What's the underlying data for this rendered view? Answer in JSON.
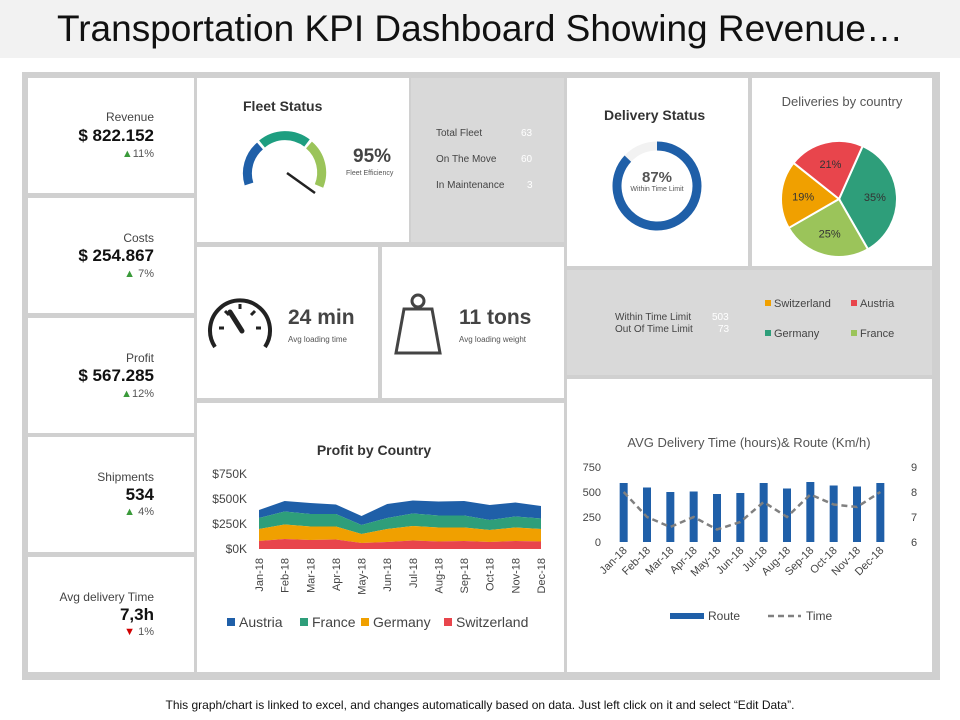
{
  "title": "Transportation KPI Dashboard Showing Revenue…",
  "footer": "This graph/chart is linked to excel, and changes automatically based on data. Just left click on it and select “Edit Data”.",
  "kpis": [
    {
      "label": "Revenue",
      "value": "$ 822.152",
      "change": "11%",
      "direction": "up"
    },
    {
      "label": "Costs",
      "value": "$ 254.867",
      "change": " 7%",
      "direction": "up"
    },
    {
      "label": "Profit",
      "value": "$ 567.285",
      "change": "12%",
      "direction": "up"
    },
    {
      "label": "Shipments",
      "value": "534",
      "change": " 4%",
      "direction": "up"
    },
    {
      "label": "Avg delivery Time",
      "value": "7,3h",
      "change": " 1%",
      "direction": "down"
    }
  ],
  "fleet": {
    "title": "Fleet Status",
    "pct": "95%",
    "pct_label": "Fleet Efficiency",
    "efficiency": 0.95,
    "stats": [
      {
        "label": "Total Fleet",
        "value": "63"
      },
      {
        "label": "On The Move",
        "value": "60"
      },
      {
        "label": "In Maintenance",
        "value": "3"
      }
    ]
  },
  "loading_time": {
    "value": "24 min",
    "label": "Avg loading time"
  },
  "loading_weight": {
    "value": "11 tons",
    "label": "Avg loading weight"
  },
  "delivery": {
    "title": "Delivery Status",
    "pct": "87%",
    "pct_label": "Within Time Limit",
    "fraction": 0.87,
    "stats": [
      {
        "label": "Within Time Limit",
        "value": "503"
      },
      {
        "label": "Out Of Time  Limit",
        "value": "73"
      }
    ]
  },
  "colors": {
    "blue": "#1f5fa8",
    "green": "#2e9e7a",
    "orange": "#f0a000",
    "red": "#e8454c",
    "lightgreen": "#9bc45a",
    "gauge_teal": "#1e9e80",
    "gauge_light": "#9bc45a",
    "gauge_blue": "#1f5fa8",
    "route_bar": "#1f5fa8",
    "time_line": "#808080"
  },
  "chart_data": [
    {
      "type": "pie",
      "title": "Deliveries by country",
      "categories": [
        "France",
        "Germany",
        "Switzerland",
        "Austria"
      ],
      "values": [
        35,
        25,
        19,
        21
      ],
      "labels": [
        "35%",
        "25%",
        "19%",
        "21%"
      ],
      "legend": [
        "Switzerland",
        "Austria",
        "Germany",
        "France"
      ]
    },
    {
      "type": "area",
      "title": "Profit by Country",
      "categories": [
        "Jan-18",
        "Feb-18",
        "Mar-18",
        "Apr-18",
        "May-18",
        "Jun-18",
        "Jul-18",
        "Aug-18",
        "Sep-18",
        "Oct-18",
        "Nov-18",
        "Dec-18"
      ],
      "series": [
        {
          "name": "Switzerland",
          "values": [
            80,
            100,
            90,
            95,
            60,
            70,
            85,
            75,
            80,
            70,
            80,
            75
          ]
        },
        {
          "name": "Germany",
          "values": [
            120,
            145,
            135,
            130,
            90,
            130,
            145,
            140,
            135,
            120,
            135,
            125
          ]
        },
        {
          "name": "France",
          "values": [
            110,
            130,
            125,
            125,
            90,
            110,
            125,
            120,
            120,
            100,
            110,
            105
          ]
        },
        {
          "name": "Austria",
          "values": [
            80,
            105,
            110,
            95,
            90,
            140,
            130,
            140,
            145,
            150,
            140,
            125
          ]
        }
      ],
      "yticks": [
        "$0K",
        "$250K",
        "$500K",
        "$750K"
      ],
      "ylim": [
        0,
        750
      ],
      "legend": [
        "Austria",
        "France",
        "Germany",
        "Switzerland"
      ]
    },
    {
      "type": "bar",
      "title": "AVG Delivery Time (hours)& Route (Km/h)",
      "categories": [
        "Jan-18",
        "Feb-18",
        "Mar-18",
        "Apr-18",
        "May-18",
        "Jun-18",
        "Jul-18",
        "Aug-18",
        "Sep-18",
        "Oct-18",
        "Nov-18",
        "Dec-18"
      ],
      "series": [
        {
          "name": "Route",
          "type": "bar",
          "axis": "left",
          "values": [
            590,
            545,
            500,
            505,
            480,
            490,
            590,
            535,
            600,
            565,
            555,
            590
          ]
        },
        {
          "name": "Time",
          "type": "line",
          "axis": "right",
          "values": [
            8.0,
            7.0,
            6.6,
            7.0,
            6.5,
            6.8,
            7.6,
            7.0,
            7.9,
            7.5,
            7.4,
            8.0
          ]
        }
      ],
      "y_left_ticks": [
        "0",
        "250",
        "500",
        "750"
      ],
      "y_left_lim": [
        0,
        750
      ],
      "y_right_ticks": [
        "6",
        "7",
        "8",
        "9"
      ],
      "y_right_lim": [
        6,
        9
      ],
      "legend": [
        "Route",
        "Time"
      ]
    }
  ]
}
